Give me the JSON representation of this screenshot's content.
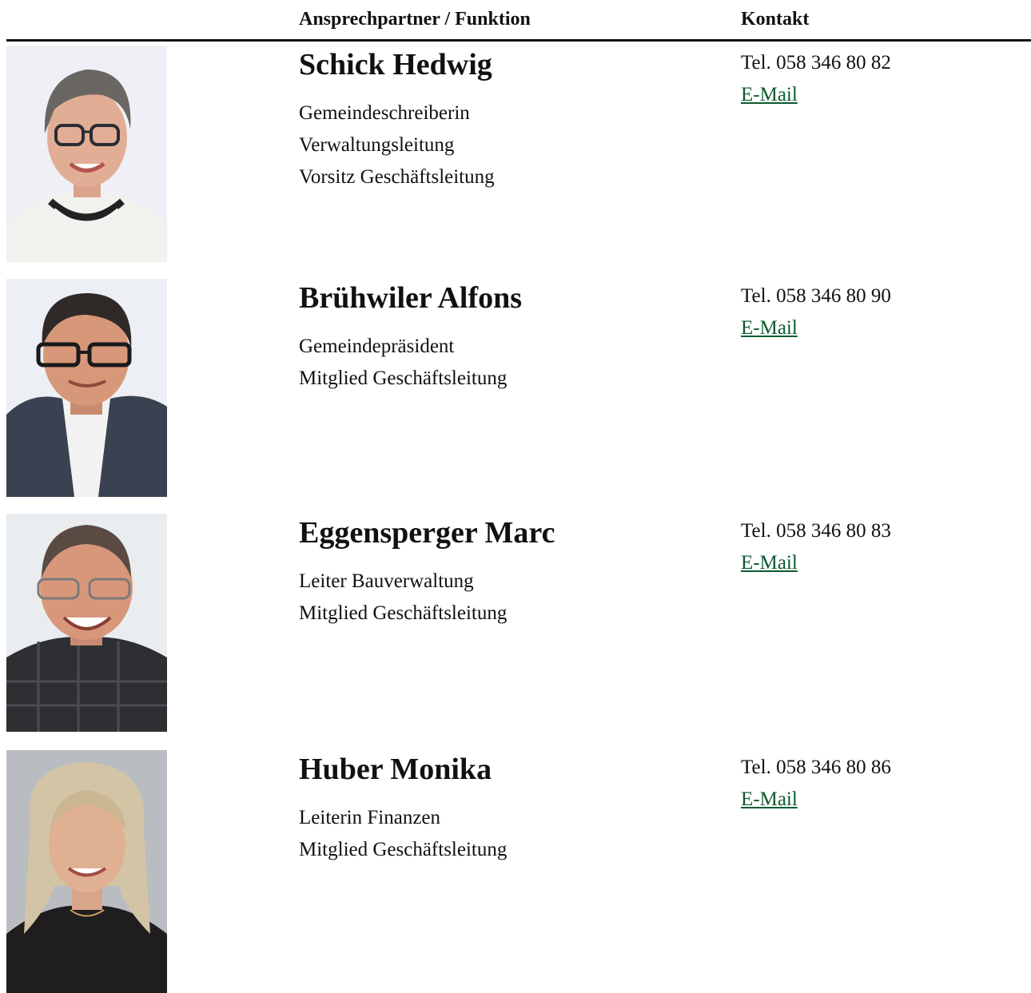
{
  "table": {
    "headers": {
      "function": "Ansprechpartner / Funktion",
      "contact": "Kontakt"
    },
    "rows": [
      {
        "name": "Schick Hedwig",
        "roles": [
          "Gemeindeschreiberin",
          "Verwaltungsleitung",
          "Vorsitz Geschäftsleitung"
        ],
        "phone": "Tel. 058 346 80 82",
        "email_label": "E-Mail"
      },
      {
        "name": "Brühwiler Alfons",
        "roles": [
          "Gemeindepräsident",
          "Mitglied Geschäftsleitung"
        ],
        "phone": "Tel. 058 346 80 90",
        "email_label": "E-Mail"
      },
      {
        "name": "Eggensperger Marc",
        "roles": [
          "Leiter Bauverwaltung",
          "Mitglied Geschäftsleitung"
        ],
        "phone": "Tel. 058 346 80 83",
        "email_label": "E-Mail"
      },
      {
        "name": "Huber Monika",
        "roles": [
          "Leiterin Finanzen",
          "Mitglied Geschäftsleitung"
        ],
        "phone": "Tel. 058 346 80 86",
        "email_label": "E-Mail"
      }
    ]
  },
  "colors": {
    "link": "#0d5a2f",
    "rule": "#111111"
  }
}
